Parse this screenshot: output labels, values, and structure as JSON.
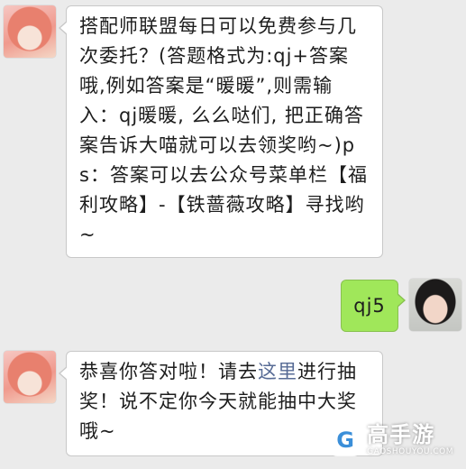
{
  "messages": [
    {
      "side": "left",
      "text": "搭配师联盟每日可以免费参与几次委托？(答题格式为:qj+答案哦,例如答案是“暖暖”,则需输入：qj暖暖, 么么哒们, 把正确答案告诉大喵就可以去领奖哟~)ps：答案可以去公众号菜单栏【福利攻略】-【铁蔷薇攻略】寻找哟~"
    },
    {
      "side": "right",
      "text": "qj5"
    },
    {
      "side": "left",
      "text_before": "恭喜你答对啦！请去",
      "link": "这里",
      "text_after": "进行抽奖！说不定你今天就能抽中大奖哦~"
    }
  ],
  "watermark": {
    "logo_letter": "G",
    "name": "高手游",
    "domain": "GAOSHOUYOU.COM"
  },
  "colors": {
    "background": "#ebebeb",
    "sent_bubble": "#a0e75a",
    "link": "#576b95"
  }
}
